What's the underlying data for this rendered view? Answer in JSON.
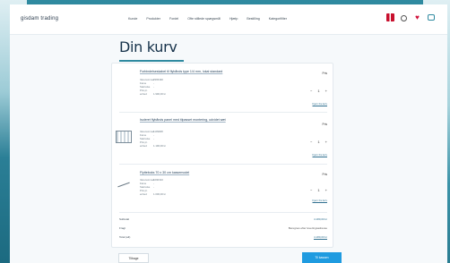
{
  "header": {
    "logo": "gisdam trading",
    "nav": [
      "Kunde",
      "Produkter",
      "Fordel",
      "Ofte stillede spørgsmål",
      "Hjælp",
      "Bestilling",
      "Kategorifilter"
    ]
  },
  "page": {
    "title": "Din kurv"
  },
  "items": [
    {
      "name": "Forbindelseskabel til flybånds type 1/4 mm, lokal standard",
      "specs": [
        {
          "k": "Varenummer",
          "v": "2365490"
        },
        {
          "k": "Farve",
          "v": "-"
        },
        {
          "k": "Størrelse",
          "v": "-"
        },
        {
          "k": "Pris pr. enhed",
          "v": "1.990,00 kr"
        }
      ],
      "price": "Pris",
      "qty": "1",
      "remove": "Fjern fra kurv"
    },
    {
      "name": "Isoleret flybånds panel med tilpasset montering, udvidet sæt",
      "specs": [
        {
          "k": "Varenummer",
          "v": "1109908"
        },
        {
          "k": "Farve",
          "v": "-"
        },
        {
          "k": "Størrelse",
          "v": "-"
        },
        {
          "k": "Pris pr. enhed",
          "v": "1.190,00 kr"
        }
      ],
      "price": "Pris",
      "qty": "1",
      "remove": "Fjern fra kurv"
    },
    {
      "name": "Flytteboks 70 x 30 cm kassemodel",
      "specs": [
        {
          "k": "Varenummer",
          "v": "1090310"
        },
        {
          "k": "Farve",
          "v": "-"
        },
        {
          "k": "Størrelse",
          "v": "-"
        },
        {
          "k": "Pris pr. enhed",
          "v": "1.000,00 kr"
        }
      ],
      "price": "Pris",
      "qty": "1",
      "remove": "Fjern fra kurv"
    }
  ],
  "totals": {
    "subtotal_label": "Subtotal",
    "subtotal_value": "4.180,00 kr",
    "shipping_label": "Fragt",
    "shipping_value": "Beregnes efter leveringsadresse",
    "total_label": "Total (alt)",
    "total_value": "4.180,00 kr"
  },
  "buttons": {
    "back": "Tilbage",
    "next": "Til kassen"
  }
}
